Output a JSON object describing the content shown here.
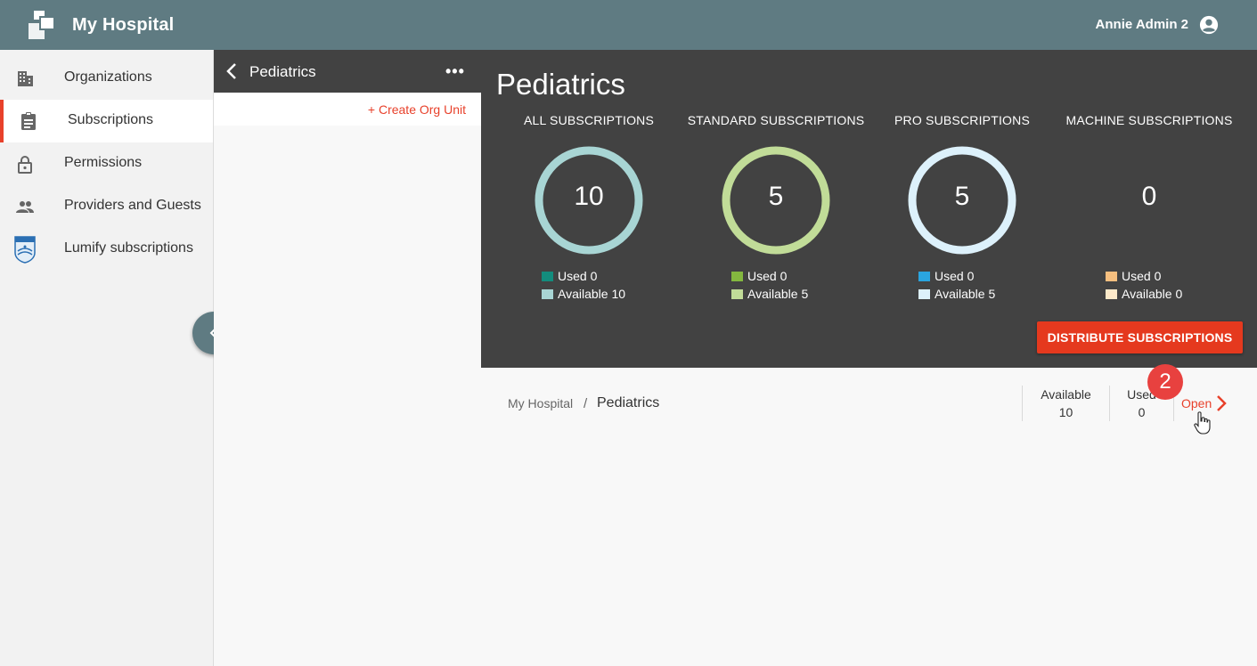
{
  "app": {
    "title": "My Hospital",
    "user_name": "Annie Admin 2"
  },
  "sidebar": {
    "items": [
      {
        "label": "Organizations",
        "icon": "building-icon"
      },
      {
        "label": "Subscriptions",
        "icon": "clipboard-icon",
        "active": true
      },
      {
        "label": "Permissions",
        "icon": "lock-icon"
      },
      {
        "label": "Providers and Guests",
        "icon": "people-icon"
      },
      {
        "label": "Lumify subscriptions",
        "icon": "philips-shield-icon"
      }
    ]
  },
  "org_panel": {
    "title": "Pediatrics",
    "more": "•••",
    "create_label": "+ Create Org Unit"
  },
  "stats": {
    "title": "Pediatrics",
    "columns": [
      {
        "heading": "ALL SUBSCRIPTIONS",
        "total": "10",
        "used_label": "Used 0",
        "available_label": "Available 10",
        "used_color": "#138c7d",
        "available_color": "#a8d5d4"
      },
      {
        "heading": "STANDARD SUBSCRIPTIONS",
        "total": "5",
        "used_label": "Used 0",
        "available_label": "Available 5",
        "used_color": "#84b83f",
        "available_color": "#c1dc98"
      },
      {
        "heading": "PRO SUBSCRIPTIONS",
        "total": "5",
        "used_label": "Used 0",
        "available_label": "Available 5",
        "used_color": "#2aa5e0",
        "available_color": "#ddf1fb"
      },
      {
        "heading": "MACHINE SUBSCRIPTIONS",
        "total": "0",
        "used_label": "Used 0",
        "available_label": "Available 0",
        "used_color": "#f6bf7f",
        "available_color": "#fde9c9"
      }
    ],
    "distribute_label": "DISTRIBUTE SUBSCRIPTIONS"
  },
  "breadcrumb": {
    "root": "My Hospital",
    "separator": "/",
    "current": "Pediatrics"
  },
  "summary": {
    "available_label": "Available",
    "available_value": "10",
    "used_label": "Used",
    "used_value": "0",
    "open_label": "Open"
  },
  "badge": "2",
  "colors": {
    "topbar": "#5f7b82",
    "accent": "#e8412b",
    "panel_dark": "#424242"
  }
}
